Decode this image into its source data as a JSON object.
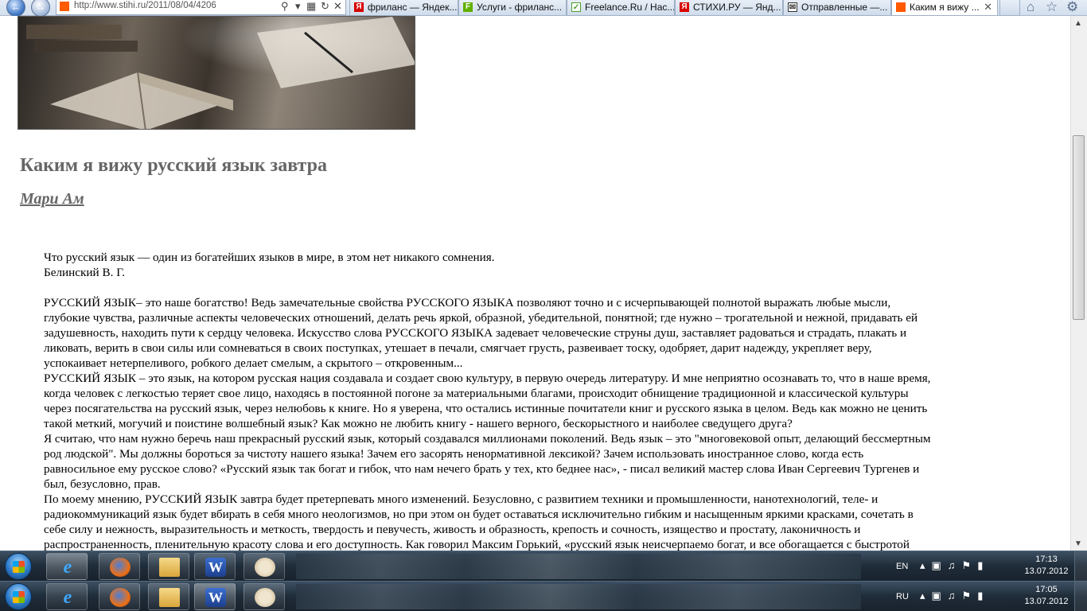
{
  "browser": {
    "url": "http://www.stihi.ru/2011/08/04/4206",
    "tabs": [
      {
        "label": "фриланс — Яндек...",
        "icon": "yandex-icon"
      },
      {
        "label": "Услуги - фриланс...",
        "icon": "fl-icon"
      },
      {
        "label": "Freelance.Ru / Нас...",
        "icon": "freelance-icon"
      },
      {
        "label": "СТИХИ.РУ — Янд...",
        "icon": "yandex-icon"
      },
      {
        "label": "Отправленные —...",
        "icon": "mail-icon"
      },
      {
        "label": "Каким я вижу ...",
        "icon": "stihi-icon"
      }
    ],
    "colors": {
      "site_accent": "#ff5a00",
      "yandex": "#d80000",
      "fl": "#61b000",
      "freelance": "#4aa02c"
    }
  },
  "page": {
    "title": "Каким я вижу русский язык завтра",
    "author": "Мари Ам",
    "lines": [
      "Что русский язык — один из богатейших языков в мире, в этом нет никакого сомнения.",
      "Белинский В. Г.",
      "",
      "РУССКИЙ ЯЗЫК– это наше богатство! Ведь замечательные свойства РУССКОГО ЯЗЫКА позволяют точно и с исчерпывающей полнотой выражать любые мысли,",
      "глубокие чувства, различные аспекты человеческих отношений, делать речь яркой, образной, убедительной, понятной; где нужно – трогательной и нежной, придавать ей",
      "задушевность, находить пути к сердцу человека. Искусство слова РУССКОГО ЯЗЫКА   задевает  человеческие струны душ, заставляет радоваться и страдать, плакать и",
      "ликовать, верить в свои силы или сомневаться в своих поступках, утешает в печали, смягчает грусть, развеивает тоску, одобряет, дарит надежду, укрепляет веру,",
      "успокаивает нетерпеливого, робкого делает смелым, а скрытого – откровенным...",
      "РУССКИЙ ЯЗЫК – это язык, на котором русская нация создавала и создает свою культуру, в первую очередь литературу. И мне неприятно осознавать то, что в наше время,",
      "когда человек с легкостью теряет свое лицо, находясь в постоянной погоне за материальными благами, происходит обнищение традиционной и классической культуры",
      "через посягательства на русский язык, через нелюбовь к книге. Но я уверена, что остались истинные почитатели книг и русского языка в целом. Ведь как можно не ценить",
      "такой меткий, могучий и поистине волшебный язык? Как можно не любить книгу - нашего верного, бескорыстного и наиболее сведущего друга?",
      " Я считаю, что нам нужно беречь наш прекрасный русский язык, который создавался миллионами поколений. Ведь язык – это \"многовековой опыт, делающий бессмертным",
      "род людской\".  Мы должны бороться за чистоту нашего языка! Зачем его засорять ненормативной лексикой? Зачем использовать иностранное слово, когда есть",
      "равносильное ему русское слово? «Русский язык так богат и гибок, что нам нечего брать у тех, кто беднее нас», - писал великий мастер слова Иван Сергеевич Тургенев и",
      "был, безусловно, прав.",
      "По моему мнению, РУССКИЙ ЯЗЫК завтра будет претерпевать много изменений. Безусловно, с развитием техники и промышленности, нанотехнологий, теле- и",
      "радиокоммуникаций язык будет вбирать в себя много неологизмов, но при этом он будет оставаться исключительно гибким и насыщенным яркими красками, сочетать в",
      "себе силу и нежность, выразительность и меткость, твердость и певучесть, живость и образность, крепость и сочность, изящество и простату, лаконичность и",
      "распространенность, пленительную красоту слова и его доступность. Как говорил Максим Горький, «русский язык неисчерпаемо богат, и все обогащается с быстротой"
    ]
  },
  "taskbars": [
    {
      "lang": "EN",
      "time": "17:13",
      "date": "13.07.2012"
    },
    {
      "lang": "RU",
      "time": "17:05",
      "date": "13.07.2012"
    }
  ]
}
